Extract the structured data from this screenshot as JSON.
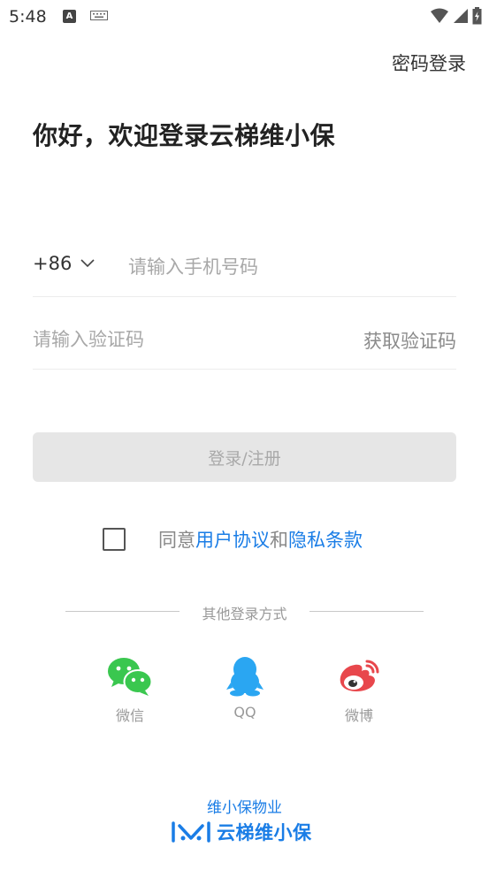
{
  "status_bar": {
    "time": "5:48",
    "icons": [
      "a-notification-icon",
      "keyboard-icon",
      "wifi-icon",
      "signal-icon",
      "battery-charging-icon"
    ]
  },
  "header": {
    "password_login_label": "密码登录"
  },
  "title": "你好，欢迎登录云梯维小保",
  "phone": {
    "country_code": "+86",
    "placeholder": "请输入手机号码",
    "value": ""
  },
  "verification": {
    "placeholder": "请输入验证码",
    "value": "",
    "get_code_label": "获取验证码"
  },
  "login_button_label": "登录/注册",
  "agreement": {
    "checked": false,
    "prefix": "同意",
    "user_agreement": "用户协议",
    "conjunction": "和",
    "privacy_terms": "隐私条款"
  },
  "other_login": {
    "divider_label": "其他登录方式",
    "options": [
      {
        "label": "微信",
        "icon": "wechat-icon",
        "color": "#3ac74f"
      },
      {
        "label": "QQ",
        "icon": "qq-icon",
        "color": "#2aa6f2"
      },
      {
        "label": "微博",
        "icon": "weibo-icon",
        "color": "#e8474c"
      }
    ]
  },
  "footer": {
    "subtitle": "维小保物业",
    "logo_text": "云梯维小保",
    "brand_color": "#1a7de6"
  }
}
